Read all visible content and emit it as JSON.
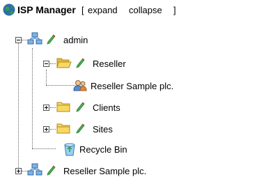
{
  "header": {
    "title": "ISP Manager",
    "bracket_open": "[",
    "expand_label": "expand",
    "collapse_label": "collapse",
    "bracket_close": "]"
  },
  "tree": {
    "admin": {
      "label": "admin"
    },
    "reseller": {
      "label": "Reseller"
    },
    "reseller_child": {
      "label": "Reseller Sample plc."
    },
    "clients": {
      "label": "Clients"
    },
    "sites": {
      "label": "Sites"
    },
    "recycle": {
      "label": "Recycle Bin"
    },
    "reseller_root": {
      "label": "Reseller Sample plc."
    }
  }
}
